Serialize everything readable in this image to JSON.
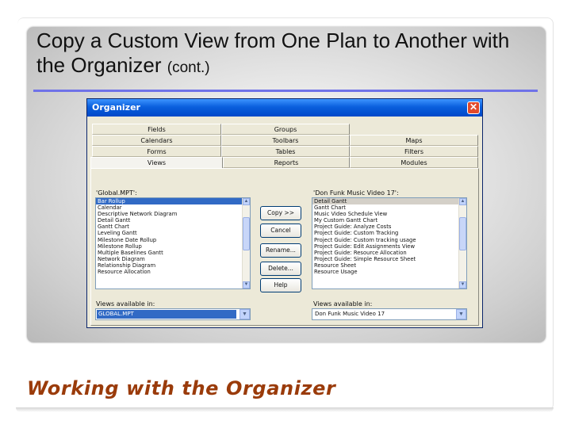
{
  "slide": {
    "title": "Copy a Custom View from One Plan to Another with the Organizer",
    "title_suffix": "(cont.)",
    "footer": "Working with the Organizer",
    "accent_color": "#6f72e8",
    "footer_color": "#9a3b0a"
  },
  "window": {
    "title": "Organizer",
    "close_icon": "close-icon",
    "tabs_row1": [
      "Fields",
      "Groups"
    ],
    "tabs_row2": [
      "Calendars",
      "Toolbars",
      "Maps"
    ],
    "tabs_row3": [
      "Forms",
      "Tables",
      "Filters"
    ],
    "tabs_row4": [
      "Views",
      "Reports",
      "Modules"
    ],
    "active_tab": "Views"
  },
  "left": {
    "label": "'Global.MPT':",
    "items": [
      "Bar Rollup",
      "Calendar",
      "Descriptive Network Diagram",
      "Detail Gantt",
      "Gantt Chart",
      "Leveling Gantt",
      "Milestone Date Rollup",
      "Milestone Rollup",
      "Multiple Baselines Gantt",
      "Network Diagram",
      "Relationship Diagram",
      "Resource Allocation"
    ],
    "selected_index": 0,
    "available_label": "Views available in:",
    "available_value": "GLOBAL.MPT"
  },
  "right": {
    "label": "'Don Funk Music Video 17':",
    "items": [
      "Detail Gantt",
      "Gantt Chart",
      "Music Video Schedule View",
      "My Custom Gantt Chart",
      "Project Guide: Analyze Costs",
      "Project Guide: Custom Tracking",
      "Project Guide: Custom tracking usage",
      "Project Guide: Edit Assignments View",
      "Project Guide: Resource Allocation",
      "Project Guide: Simple Resource Sheet",
      "Resource Sheet",
      "Resource Usage"
    ],
    "selected_index": 0,
    "available_label": "Views available in:",
    "available_value": "Don Funk Music Video 17"
  },
  "buttons": {
    "copy": "Copy >>",
    "cancel": "Cancel",
    "rename": "Rename...",
    "delete": "Delete...",
    "help": "Help"
  }
}
